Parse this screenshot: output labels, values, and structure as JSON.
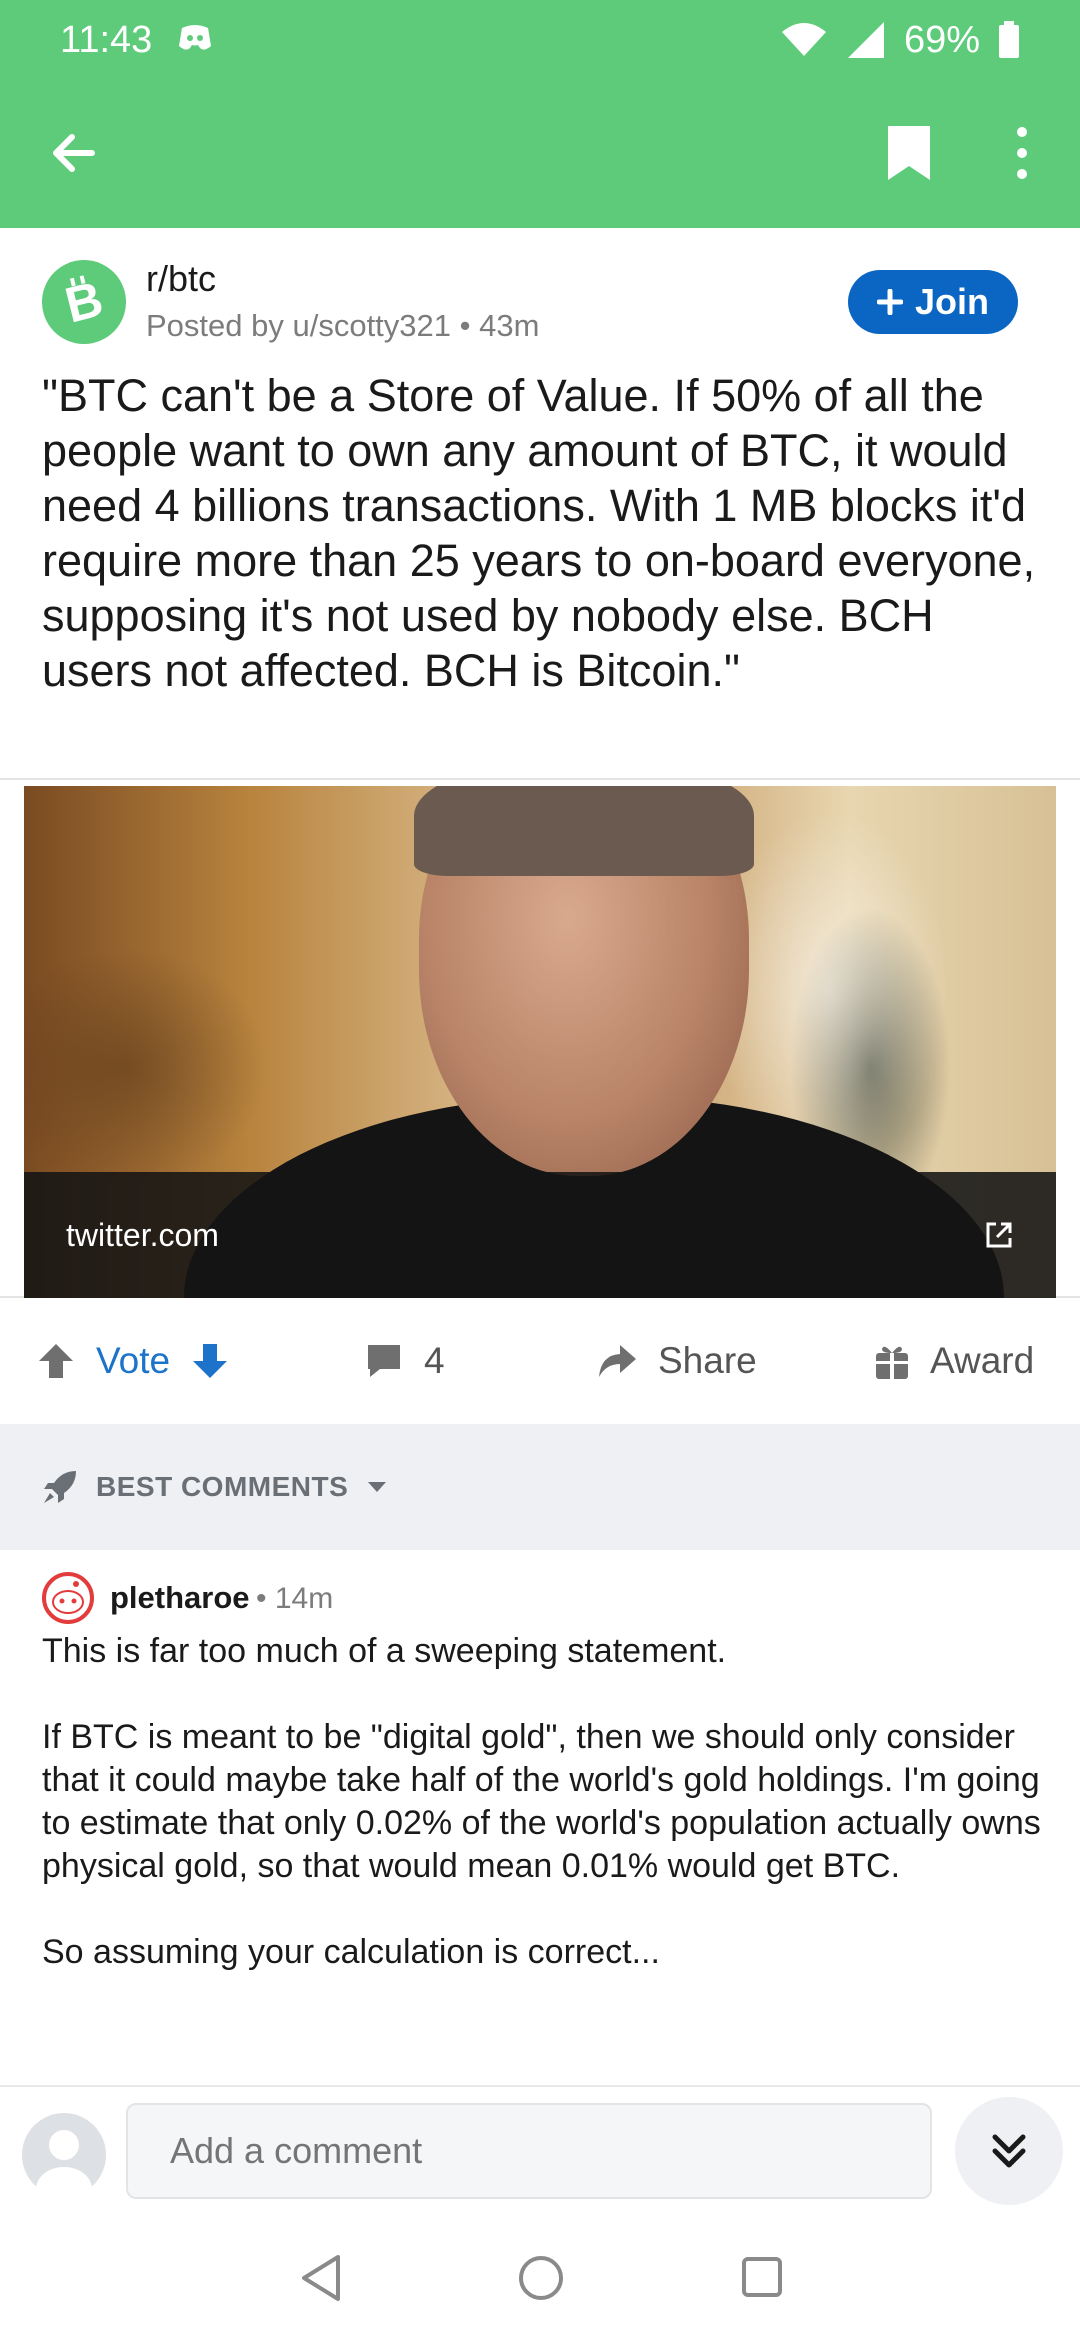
{
  "status_bar": {
    "time": "11:43",
    "battery": "69%"
  },
  "post": {
    "subreddit": "r/btc",
    "posted_by": "Posted by u/scotty321",
    "age": "43m",
    "join_label": "Join",
    "title": "\"BTC can't be a Store of Value. If 50% of all the people want to own any amount of BTC, it would need 4 billions transactions. With 1 MB blocks it'd require more than 25 years to on-board everyone, supposing it's not used by nobody else. BCH users not affected. BCH is Bitcoin.\"",
    "link_domain": "twitter.com"
  },
  "actions": {
    "vote_label": "Vote",
    "comment_count": "4",
    "share_label": "Share",
    "award_label": "Award"
  },
  "sort": {
    "label": "BEST COMMENTS"
  },
  "comment": {
    "author": "pletharoe",
    "age": "14m",
    "paragraphs": [
      "This is far too much of a sweeping statement.",
      "If BTC is meant to be \"digital gold\", then we should only consider that it could maybe take half of the world's gold holdings.  I'm going to estimate that only 0.02% of the world's population actually owns physical gold, so that would mean 0.01% would get BTC.",
      "So assuming your calculation is correct..."
    ]
  },
  "input": {
    "placeholder": "Add a comment"
  },
  "colors": {
    "app_bar": "#5ecb7b",
    "accent_blue": "#0a66c2",
    "vote_blue": "#1c73c9"
  }
}
